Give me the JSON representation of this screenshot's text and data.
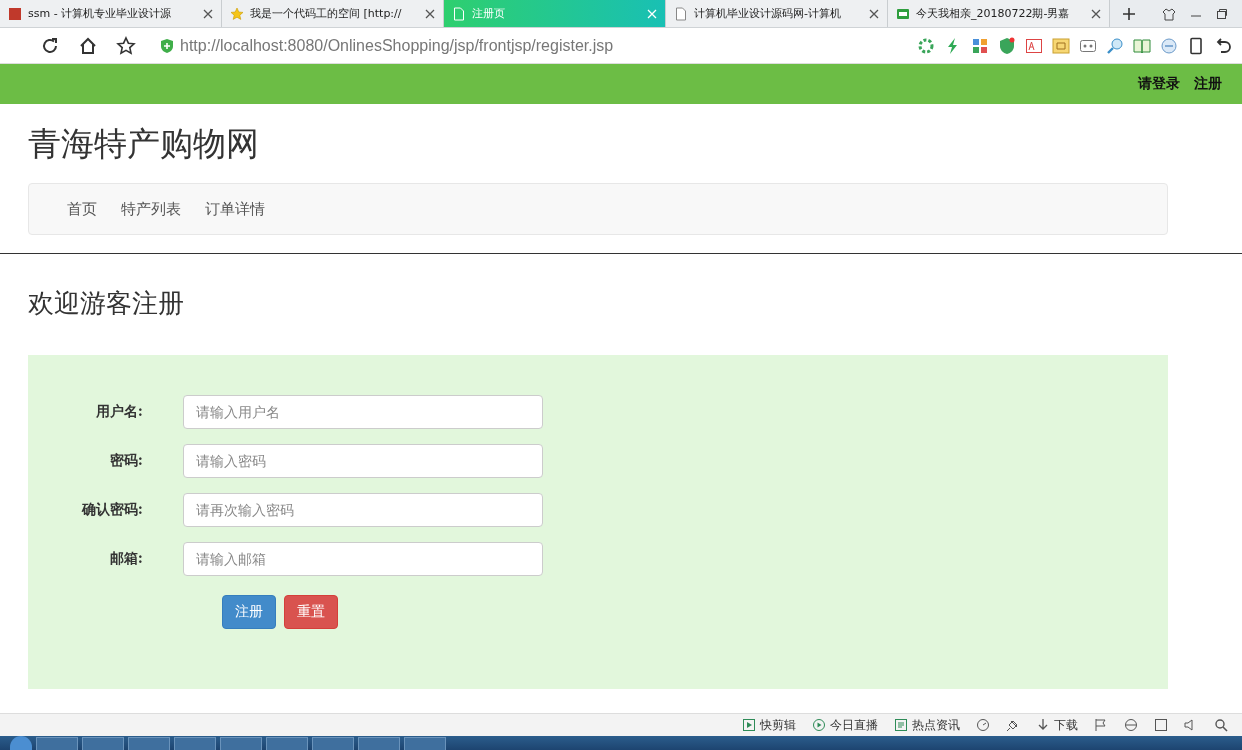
{
  "browser": {
    "tabs": [
      {
        "title": "ssm - 计算机专业毕业设计源",
        "selected": false,
        "kind": "red"
      },
      {
        "title": "我是一个代码工的空间 [http://",
        "selected": false,
        "kind": "star"
      },
      {
        "title": "注册页",
        "selected": true,
        "kind": "page"
      },
      {
        "title": "计算机毕业设计源码网-计算机",
        "selected": false,
        "kind": "page"
      },
      {
        "title": "今天我相亲_20180722期-男嘉",
        "selected": false,
        "kind": "video"
      }
    ],
    "address": "http://localhost:8080/OnlinesShopping/jsp/frontjsp/register.jsp"
  },
  "site": {
    "top_links": [
      "请登录",
      "注册"
    ],
    "title": "青海特产购物网",
    "nav": [
      "首页",
      "特产列表",
      "订单详情"
    ],
    "heading": "欢迎游客注册",
    "form": {
      "fields": [
        {
          "label": "用户名:",
          "placeholder": "请输入用户名"
        },
        {
          "label": "密码:",
          "placeholder": "请输入密码"
        },
        {
          "label": "确认密码:",
          "placeholder": "请再次输入密码"
        },
        {
          "label": "邮箱:",
          "placeholder": "请输入邮箱"
        }
      ],
      "buttons": [
        {
          "label": "注册",
          "kind": "primary"
        },
        {
          "label": "重置",
          "kind": "danger"
        }
      ]
    }
  },
  "status_bar": {
    "items": [
      {
        "label": "快剪辑",
        "kind": "clip"
      },
      {
        "label": "今日直播",
        "kind": "play"
      },
      {
        "label": "热点资讯",
        "kind": "news"
      },
      {
        "label": "下载",
        "kind": "download"
      }
    ]
  }
}
